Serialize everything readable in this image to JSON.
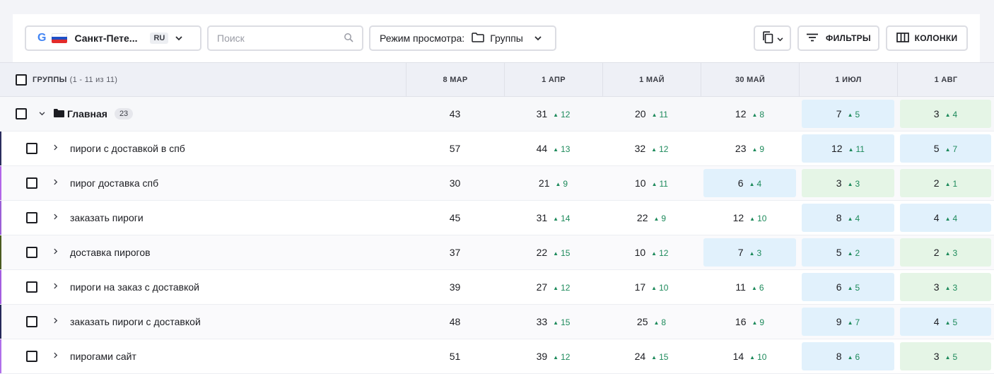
{
  "toolbar": {
    "region": {
      "engine_logo": "G",
      "name": "Санкт-Пете...",
      "lang": "RU"
    },
    "search": {
      "placeholder": "Поиск",
      "value": ""
    },
    "view_mode": {
      "label": "Режим просмотра:",
      "value": "Группы"
    },
    "filters_label": "ФИЛЬТРЫ",
    "columns_label": "КОЛОНКИ"
  },
  "table": {
    "group_header": "ГРУППЫ",
    "group_count": "(1 - 11 из 11)",
    "columns": [
      "8 МАР",
      "1 АПР",
      "1 МАЙ",
      "30 МАЙ",
      "1 ИЮЛ",
      "1 АВГ"
    ],
    "main_row": {
      "name": "Главная",
      "badge": "23",
      "cells": [
        {
          "value": "43",
          "delta": "",
          "hl": ""
        },
        {
          "value": "31",
          "delta": "12",
          "hl": ""
        },
        {
          "value": "20",
          "delta": "11",
          "hl": ""
        },
        {
          "value": "12",
          "delta": "8",
          "hl": ""
        },
        {
          "value": "7",
          "delta": "5",
          "hl": "blue"
        },
        {
          "value": "3",
          "delta": "4",
          "hl": "green"
        }
      ]
    },
    "rows": [
      {
        "name": "пироги с доставкой в спб",
        "marker": "#2b2d5e",
        "cells": [
          {
            "value": "57",
            "delta": "",
            "hl": ""
          },
          {
            "value": "44",
            "delta": "13",
            "hl": ""
          },
          {
            "value": "32",
            "delta": "12",
            "hl": ""
          },
          {
            "value": "23",
            "delta": "9",
            "hl": ""
          },
          {
            "value": "12",
            "delta": "11",
            "hl": "blue"
          },
          {
            "value": "5",
            "delta": "7",
            "hl": "blue"
          }
        ]
      },
      {
        "name": "пирог доставка спб",
        "marker": "#b366e8",
        "cells": [
          {
            "value": "30",
            "delta": "",
            "hl": ""
          },
          {
            "value": "21",
            "delta": "9",
            "hl": ""
          },
          {
            "value": "10",
            "delta": "11",
            "hl": ""
          },
          {
            "value": "6",
            "delta": "4",
            "hl": "blue"
          },
          {
            "value": "3",
            "delta": "3",
            "hl": "green"
          },
          {
            "value": "2",
            "delta": "1",
            "hl": "green"
          }
        ]
      },
      {
        "name": "заказать пироги",
        "marker": "#9b5fd6",
        "cells": [
          {
            "value": "45",
            "delta": "",
            "hl": ""
          },
          {
            "value": "31",
            "delta": "14",
            "hl": ""
          },
          {
            "value": "22",
            "delta": "9",
            "hl": ""
          },
          {
            "value": "12",
            "delta": "10",
            "hl": ""
          },
          {
            "value": "8",
            "delta": "4",
            "hl": "blue"
          },
          {
            "value": "4",
            "delta": "4",
            "hl": "blue"
          }
        ]
      },
      {
        "name": "доставка пирогов",
        "marker": "#4a5a20",
        "cells": [
          {
            "value": "37",
            "delta": "",
            "hl": ""
          },
          {
            "value": "22",
            "delta": "15",
            "hl": ""
          },
          {
            "value": "10",
            "delta": "12",
            "hl": ""
          },
          {
            "value": "7",
            "delta": "3",
            "hl": "blue"
          },
          {
            "value": "5",
            "delta": "2",
            "hl": "blue"
          },
          {
            "value": "2",
            "delta": "3",
            "hl": "green"
          }
        ]
      },
      {
        "name": "пироги на заказ с доставкой",
        "marker": "#a45ee0",
        "cells": [
          {
            "value": "39",
            "delta": "",
            "hl": ""
          },
          {
            "value": "27",
            "delta": "12",
            "hl": ""
          },
          {
            "value": "17",
            "delta": "10",
            "hl": ""
          },
          {
            "value": "11",
            "delta": "6",
            "hl": ""
          },
          {
            "value": "6",
            "delta": "5",
            "hl": "blue"
          },
          {
            "value": "3",
            "delta": "3",
            "hl": "green"
          }
        ]
      },
      {
        "name": "заказать пироги с доставкой",
        "marker": "#25285a",
        "cells": [
          {
            "value": "48",
            "delta": "",
            "hl": ""
          },
          {
            "value": "33",
            "delta": "15",
            "hl": ""
          },
          {
            "value": "25",
            "delta": "8",
            "hl": ""
          },
          {
            "value": "16",
            "delta": "9",
            "hl": ""
          },
          {
            "value": "9",
            "delta": "7",
            "hl": "blue"
          },
          {
            "value": "4",
            "delta": "5",
            "hl": "blue"
          }
        ]
      },
      {
        "name": "пирогами сайт",
        "marker": "#b070ea",
        "cells": [
          {
            "value": "51",
            "delta": "",
            "hl": ""
          },
          {
            "value": "39",
            "delta": "12",
            "hl": ""
          },
          {
            "value": "24",
            "delta": "15",
            "hl": ""
          },
          {
            "value": "14",
            "delta": "10",
            "hl": ""
          },
          {
            "value": "8",
            "delta": "6",
            "hl": "blue"
          },
          {
            "value": "3",
            "delta": "5",
            "hl": "green"
          }
        ]
      }
    ]
  },
  "colors": {
    "delta_green": "#1d8a5b",
    "hl_blue": "#e1f1fc",
    "hl_green": "#e5f5e6"
  }
}
